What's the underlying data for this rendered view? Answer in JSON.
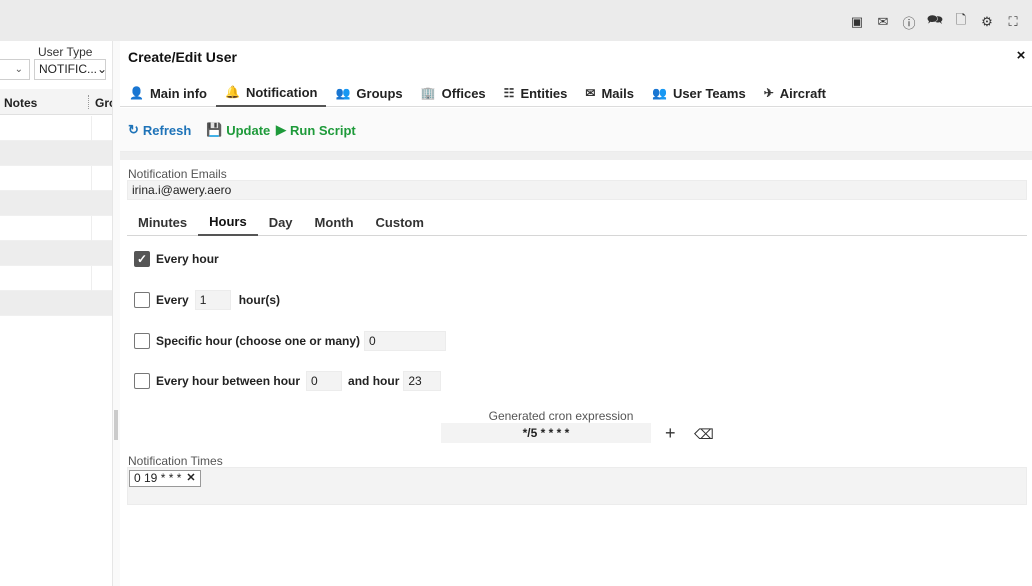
{
  "topbar": {
    "icons": [
      "message-icon",
      "mail-icon",
      "info-icon",
      "chat-icon",
      "document-lock-icon",
      "gear-icon",
      "fullscreen-icon"
    ]
  },
  "leftpane": {
    "user_type_label": "User Type",
    "user_type_value": "NOTIFIC...",
    "col_notes": "Notes",
    "col_groups": "Gro"
  },
  "panel": {
    "title": "Create/Edit User",
    "close": "×"
  },
  "tabs": [
    {
      "label": "Main info",
      "icon": "user-icon"
    },
    {
      "label": "Notification",
      "icon": "bell-icon"
    },
    {
      "label": "Groups",
      "icon": "users-icon"
    },
    {
      "label": "Offices",
      "icon": "building-icon"
    },
    {
      "label": "Entities",
      "icon": "entities-icon"
    },
    {
      "label": "Mails",
      "icon": "envelope-icon"
    },
    {
      "label": "User Teams",
      "icon": "teams-icon"
    },
    {
      "label": "Aircraft",
      "icon": "plane-icon"
    }
  ],
  "active_tab": "Notification",
  "toolbar": {
    "refresh": "Refresh",
    "update": "Update",
    "run_script": "Run Script"
  },
  "notification_emails": {
    "label": "Notification Emails",
    "value": "irina.i@awery.aero"
  },
  "subtabs": [
    "Minutes",
    "Hours",
    "Day",
    "Month",
    "Custom"
  ],
  "active_subtab": "Hours",
  "options": {
    "every_hour": {
      "label": "Every hour",
      "checked": true
    },
    "every_n": {
      "label": "Every",
      "value": "1",
      "suffix": "hour(s)",
      "checked": false
    },
    "specific": {
      "label": "Specific hour (choose one or many)",
      "value": "0",
      "checked": false
    },
    "between": {
      "label": "Every hour between hour",
      "from": "0",
      "and_label": "and hour",
      "to": "23",
      "checked": false
    }
  },
  "cron": {
    "label": "Generated cron expression",
    "value": "*/5 * * * *"
  },
  "notification_times": {
    "label": "Notification Times",
    "chips": [
      "0 19 * * *"
    ]
  },
  "colors": {
    "accent_blue": "#1e73b8",
    "accent_green": "#1e9a3a"
  }
}
